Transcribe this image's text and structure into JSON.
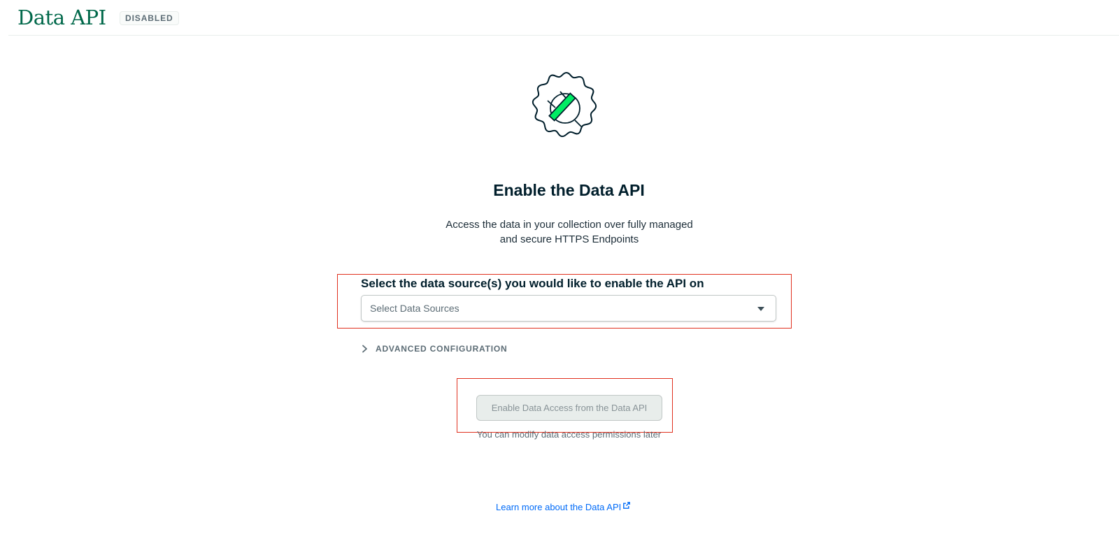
{
  "header": {
    "title": "Data API",
    "status_badge": "DISABLED"
  },
  "hero": {
    "icon": "gear-plug-icon",
    "accent_color": "#00ed64",
    "title": "Enable the Data API",
    "description_line1": "Access the data in your collection over fully managed",
    "description_line2": "and secure HTTPS Endpoints"
  },
  "data_source": {
    "label": "Select the data source(s) you would like to enable the API on",
    "placeholder": "Select Data Sources"
  },
  "advanced": {
    "label": "ADVANCED CONFIGURATION"
  },
  "enable": {
    "button_label": "Enable Data Access from the Data API",
    "hint": "You can modify data access permissions later"
  },
  "learn_more": {
    "label": "Learn more about the Data API"
  },
  "colors": {
    "brand_green": "#00684a",
    "link_blue": "#016bf8",
    "highlight_red": "#e0301e"
  }
}
